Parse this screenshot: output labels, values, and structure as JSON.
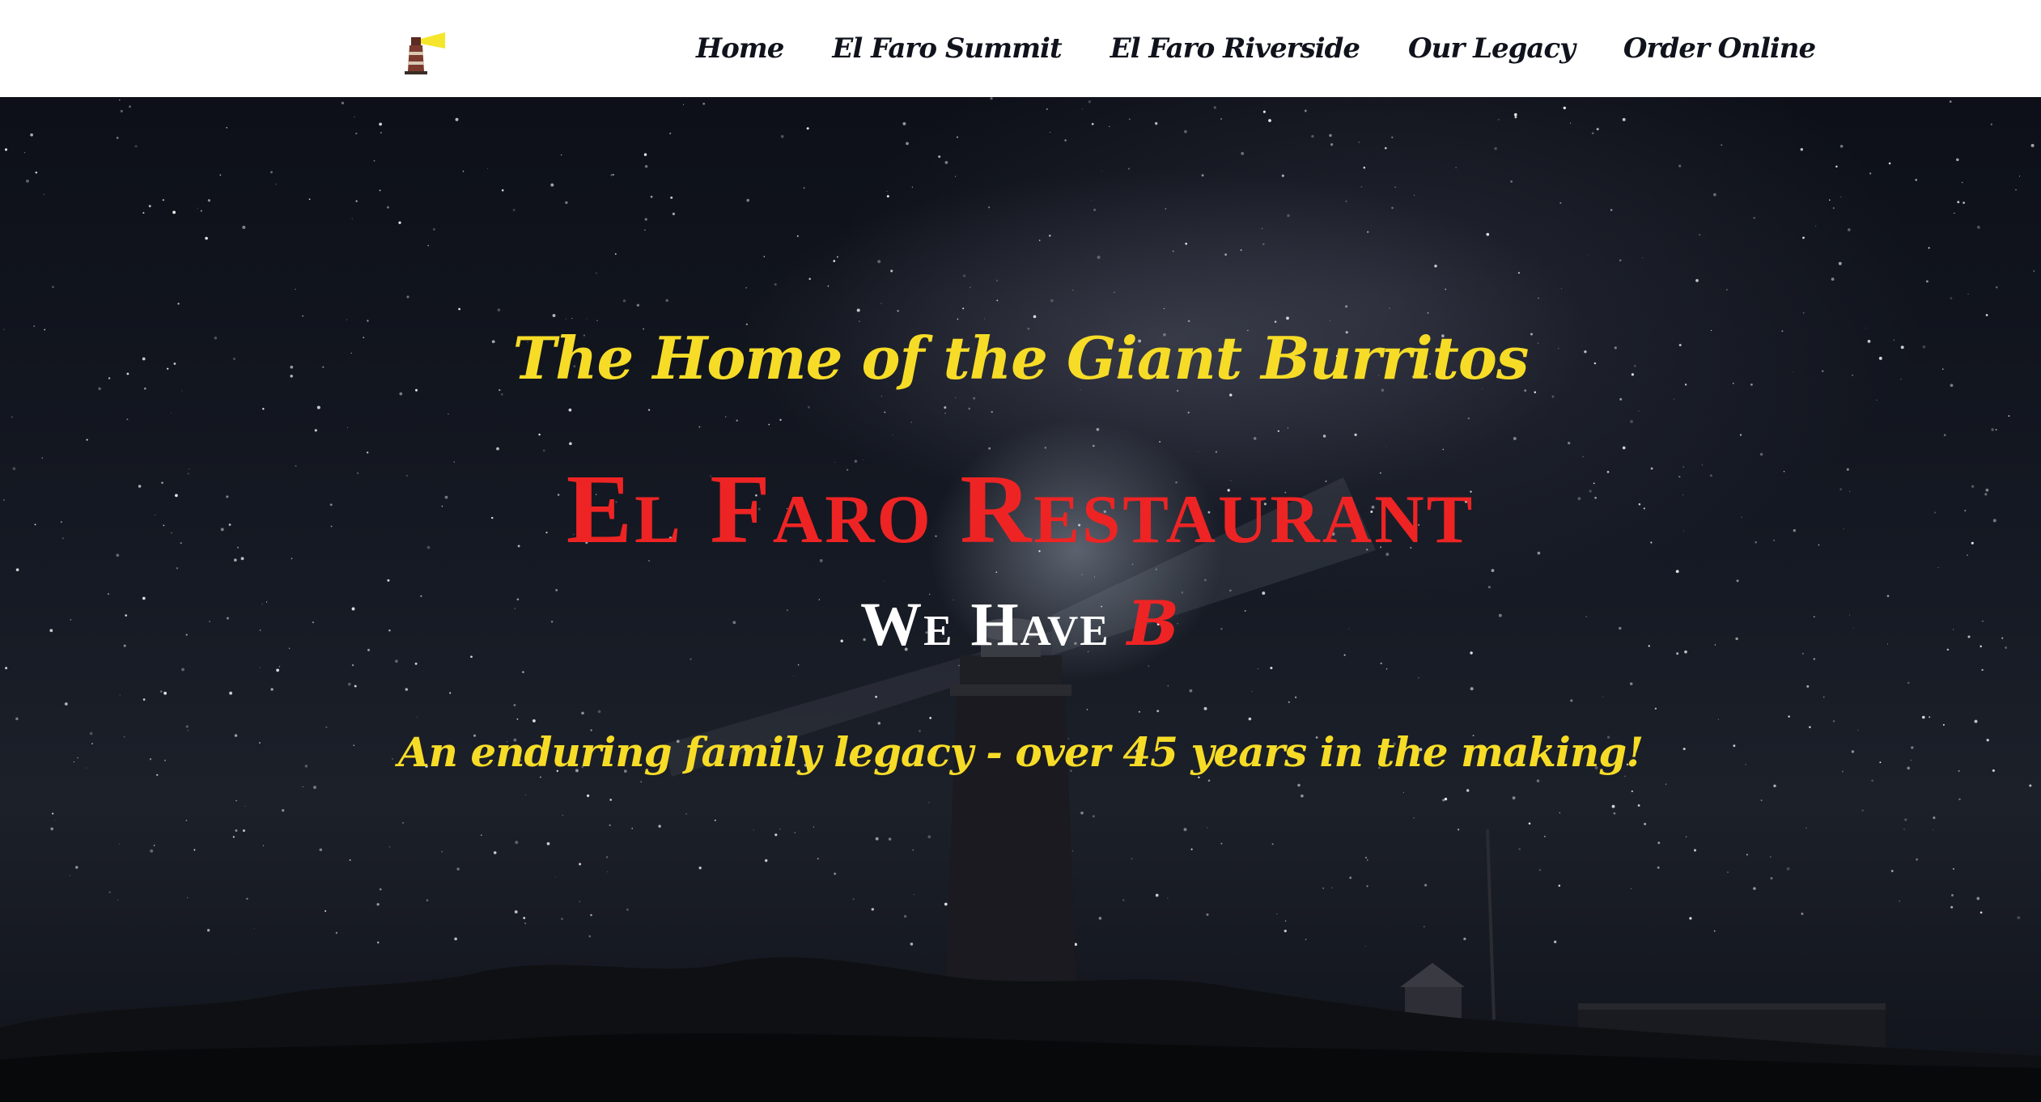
{
  "nav": {
    "logo_icon": "lighthouse-icon",
    "links": [
      "Home",
      "El Faro Summit",
      "El Faro Riverside",
      "Our Legacy",
      "Order Online"
    ]
  },
  "hero": {
    "tagline": "The Home of the Giant Burritos",
    "title": "El Faro Restaurant",
    "subtitle_prefix": "We Have ",
    "subtitle_accent": "B",
    "legacy_text": "An enduring family legacy - over 45 years in the making!",
    "background_icon": "lighthouse-night-sky-image"
  },
  "colors": {
    "accent_yellow": "#f7dc27",
    "accent_red": "#ee2424",
    "nav_text": "#10131c",
    "nav_background": "#ffffff"
  }
}
